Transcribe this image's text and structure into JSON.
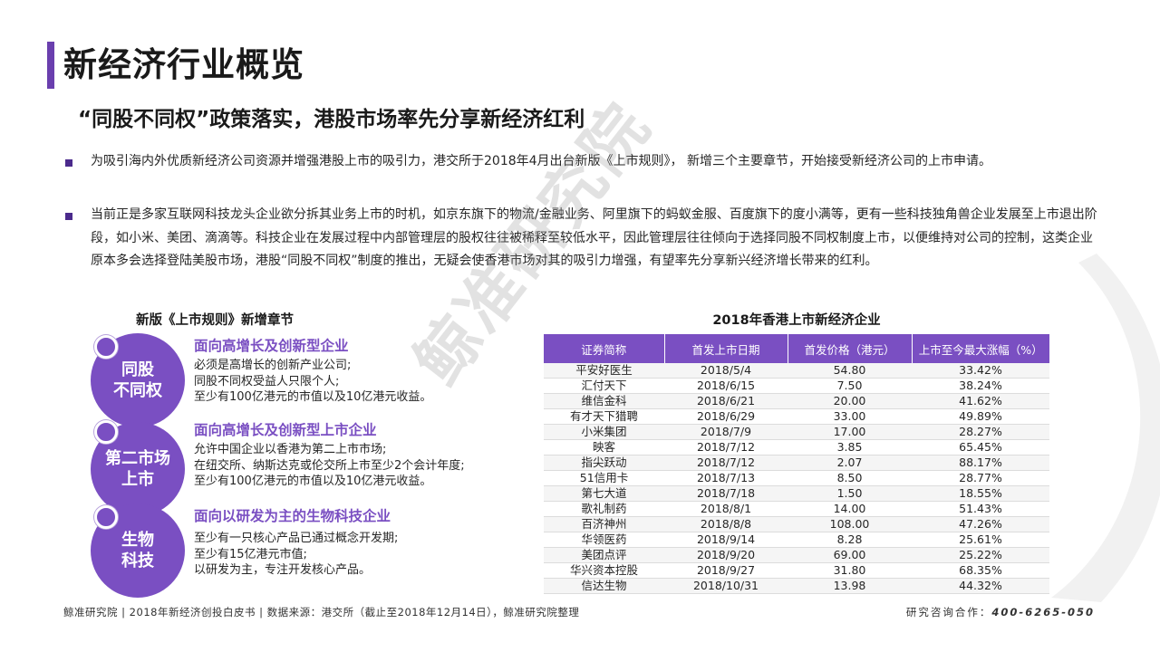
{
  "page_title": "新经济行业概览",
  "subtitle": "“同股不同权”政策落实，港股市场率先分享新经济红利",
  "paragraphs": [
    "为吸引海内外优质新经济公司资源并增强港股上市的吸引力，港交所于2018年4月出台新版《上市规则》， 新增三个主要章节，开始接受新经济公司的上市申请。",
    "当前正是多家互联网科技龙头企业欲分拆其业务上市的时机，如京东旗下的物流/金融业务、阿里旗下的蚂蚁金服、百度旗下的度小满等，更有一些科技独角兽企业发展至上市退出阶段，如小米、美团、滴滴等。科技企业在发展过程中内部管理层的股权往往被稀释至较低水平，因此管理层往往倾向于选择同股不同权制度上市，以便维持对公司的控制，这类企业原本多会选择登陆美股市场，港股“同股不同权”制度的推出，无疑会使香港市场对其的吸引力增强，有望率先分享新兴经济增长带来的红利。"
  ],
  "watermark": "鲸准研究院",
  "left_section": {
    "heading": "新版《上市规则》新增章节",
    "items": [
      {
        "circle_label": "同股\n不同权",
        "title": "面向高增长及创新型企业",
        "lines": [
          "必须是高增长的创新产业公司;",
          "同股不同权受益人只限个人;",
          "至少有100亿港元的市值以及10亿港元收益。"
        ]
      },
      {
        "circle_label": "第二市场\n上市",
        "title": "面向高增长及创新型上市企业",
        "lines": [
          "允许中国企业以香港为第二上市市场;",
          "在纽交所、纳斯达克或伦交所上市至少2个会计年度;",
          "至少有100亿港元的市值以及10亿港元收益。"
        ]
      },
      {
        "circle_label": "生物\n科技",
        "title": "面向以研发为主的生物科技企业",
        "lines": [
          "至少有一只核心产品已通过概念开发期;",
          "至少有15亿港元市值;",
          "以研发为主，专注开发核心产品。"
        ]
      }
    ]
  },
  "table": {
    "title": "2018年香港上市新经济企业",
    "headers": [
      "证券简称",
      "首发上市日期",
      "首发价格（港元）",
      "上市至今最大涨幅（%）"
    ],
    "rows": [
      [
        "平安好医生",
        "2018/5/4",
        "54.80",
        "33.42%"
      ],
      [
        "汇付天下",
        "2018/6/15",
        "7.50",
        "38.24%"
      ],
      [
        "维信金科",
        "2018/6/21",
        "20.00",
        "41.62%"
      ],
      [
        "有才天下猎聘",
        "2018/6/29",
        "33.00",
        "49.89%"
      ],
      [
        "小米集团",
        "2018/7/9",
        "17.00",
        "28.27%"
      ],
      [
        "映客",
        "2018/7/12",
        "3.85",
        "65.45%"
      ],
      [
        "指尖跃动",
        "2018/7/12",
        "2.07",
        "88.17%"
      ],
      [
        "51信用卡",
        "2018/7/13",
        "8.50",
        "28.77%"
      ],
      [
        "第七大道",
        "2018/7/18",
        "1.50",
        "18.55%"
      ],
      [
        "歌礼制药",
        "2018/8/1",
        "14.00",
        "51.43%"
      ],
      [
        "百济神州",
        "2018/8/8",
        "108.00",
        "47.26%"
      ],
      [
        "华领医药",
        "2018/9/14",
        "8.28",
        "25.61%"
      ],
      [
        "美团点评",
        "2018/9/20",
        "69.00",
        "25.22%"
      ],
      [
        "华兴资本控股",
        "2018/9/27",
        "31.80",
        "68.35%"
      ],
      [
        "信达生物",
        "2018/10/31",
        "13.98",
        "44.32%"
      ]
    ]
  },
  "footer": {
    "left": "鲸准研究院 | 2018年新经济创投白皮书 | 数据来源：港交所（截止至2018年12月14日），鲸准研究院整理",
    "contact_label": "研究咨询合作：",
    "phone": "400-6265-050"
  },
  "colors": {
    "accent": "#7a4fc2",
    "title_bar": "#6a3fae",
    "bullet": "#4b2a8c"
  }
}
